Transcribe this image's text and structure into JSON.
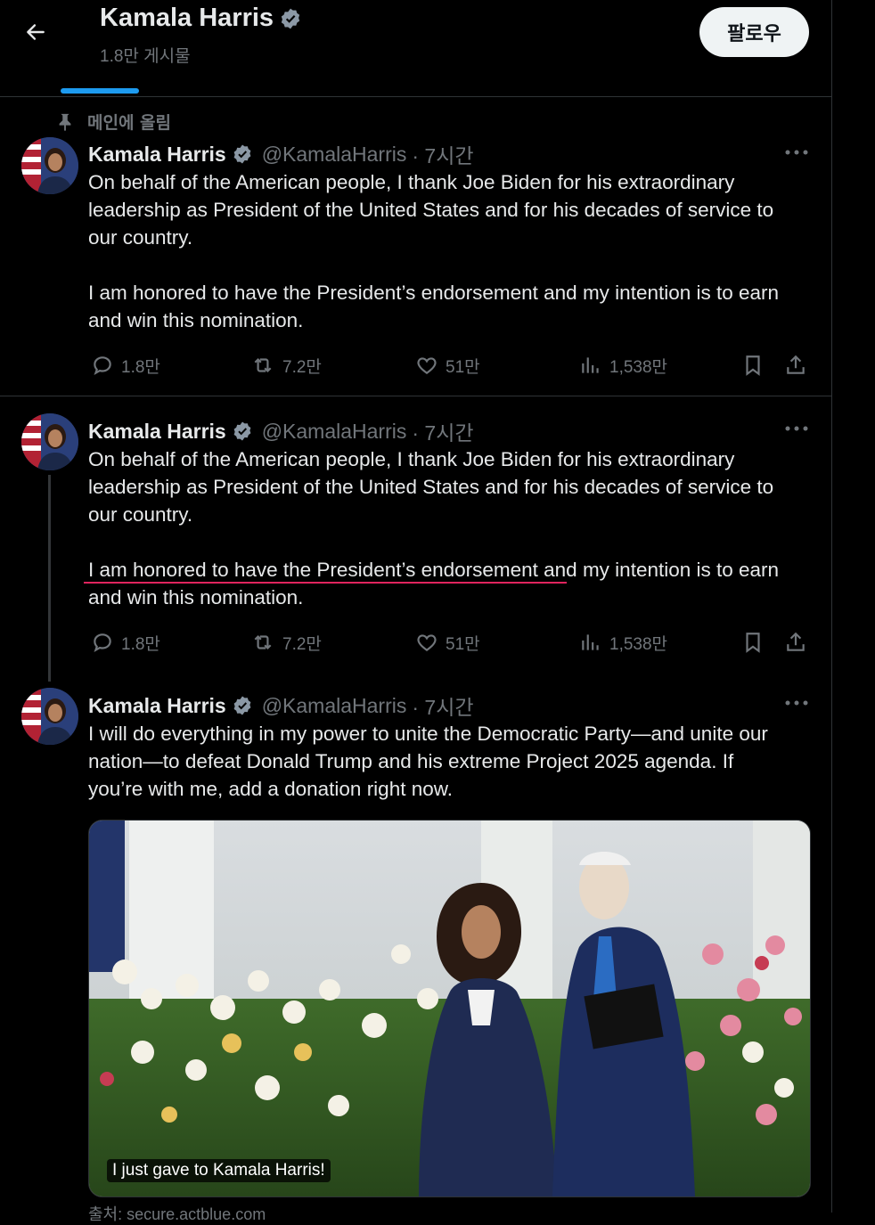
{
  "header": {
    "name": "Kamala Harris",
    "post_count": "1.8만 게시물",
    "follow_label": "팔로우",
    "back_icon": "arrow-left-icon"
  },
  "pinned_label": "메인에 올림",
  "colors": {
    "background": "#000000",
    "accent": "#1d9bf0",
    "secondary_text": "#71767b",
    "verified": "#1d9bf0",
    "underline_mark": "#e0245e"
  },
  "tweets": [
    {
      "name": "Kamala Harris",
      "handle": "@KamalaHarris",
      "time": "· 7시간",
      "text": "On behalf of the American people, I thank Joe Biden for his extraordinary\nleadership as President of the United States and for his decades of service to\nour country.\n\nI am honored to have the President’s endorsement and my intention is to earn\nand win this nomination.",
      "replies": "1.8만",
      "reposts": "7.2만",
      "likes": "51만",
      "views": "1,538만"
    },
    {
      "name": "Kamala Harris",
      "handle": "@KamalaHarris",
      "time": "· 7시간",
      "text": "On behalf of the American people, I thank Joe Biden for his extraordinary\nleadership as President of the United States and for his decades of service to\nour country.\n\nI am honored to have the President’s endorsement and my intention is to earn\nand win this nomination.",
      "replies": "1.8만",
      "reposts": "7.2만",
      "likes": "51만",
      "views": "1,538만"
    },
    {
      "name": "Kamala Harris",
      "handle": "@KamalaHarris",
      "time": "· 7시간",
      "text": "I will do everything in my power to unite the Democratic Party—and unite our\nnation—to defeat Donald Trump and his extreme Project 2025 agenda. If\nyou’re with me, add a donation right now.",
      "media_caption": "I just gave to Kamala Harris!",
      "source": "출처: secure.actblue.com"
    }
  ]
}
